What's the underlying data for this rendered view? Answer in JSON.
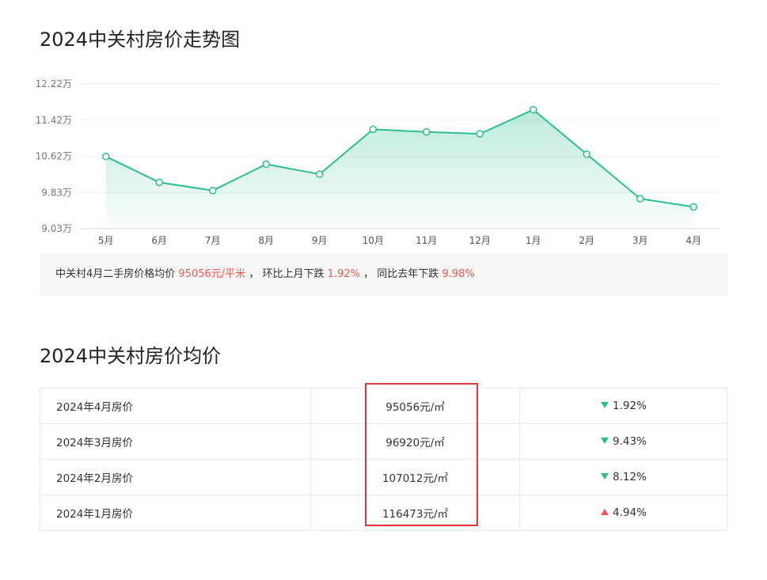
{
  "section1": {
    "title": "2024中关村房价走势图"
  },
  "chart_data": {
    "type": "area",
    "categories": [
      "5月",
      "6月",
      "7月",
      "8月",
      "9月",
      "10月",
      "11月",
      "12月",
      "1月",
      "2月",
      "3月",
      "4月"
    ],
    "values": [
      10.62,
      10.05,
      9.87,
      10.45,
      10.23,
      11.22,
      11.16,
      11.12,
      11.65,
      10.67,
      9.69,
      9.51
    ],
    "yticks": [
      "12.22万",
      "11.42万",
      "10.62万",
      "9.83万",
      "9.03万"
    ],
    "ylim": [
      9.03,
      12.22
    ],
    "grid": true,
    "line_color": "#2cc087",
    "fill_color": "#c9f0dd"
  },
  "summary": {
    "prefix": "中关村4月二手房价格均价",
    "price": "95056元/平米",
    "sep1": "，",
    "mom_text": "环比上月下跌",
    "mom_value": "1.92%",
    "sep2": "，",
    "yoy_text": "同比去年下跌",
    "yoy_value": "9.98%"
  },
  "section2": {
    "title": "2024中关村房价均价"
  },
  "table": {
    "rows": [
      {
        "label": "2024年4月房价",
        "price": "95056元/㎡",
        "change": "1.92%",
        "direction": "down"
      },
      {
        "label": "2024年3月房价",
        "price": "96920元/㎡",
        "change": "9.43%",
        "direction": "down"
      },
      {
        "label": "2024年2月房价",
        "price": "107012元/㎡",
        "change": "8.12%",
        "direction": "down"
      },
      {
        "label": "2024年1月房价",
        "price": "116473元/㎡",
        "change": "4.94%",
        "direction": "up"
      }
    ]
  },
  "colors": {
    "red": "#f2574e",
    "green": "#2cc087",
    "highlight_border": "#e0373b"
  }
}
